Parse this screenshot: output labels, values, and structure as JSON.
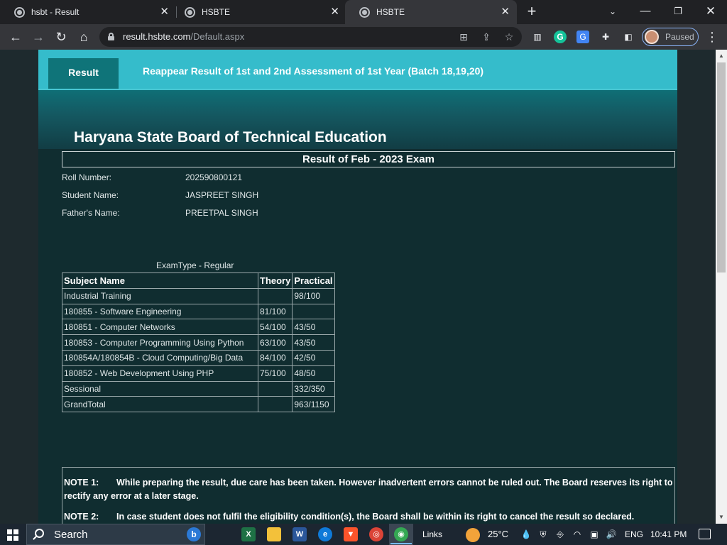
{
  "browser": {
    "tabs": [
      {
        "title": "hsbt - Result",
        "active": false
      },
      {
        "title": "HSBTE",
        "active": false
      },
      {
        "title": "HSBTE",
        "active": true
      }
    ],
    "new_tab_label": "+",
    "url_host": "result.hsbte.com",
    "url_path": "/Default.aspx",
    "profile_status": "Paused",
    "icons": [
      "back-icon",
      "forward-icon",
      "reload-icon",
      "home-icon",
      "lock-icon",
      "translate-icon",
      "share-icon",
      "star-icon",
      "extension-icon",
      "side-panel-icon",
      "menu-icon"
    ]
  },
  "site": {
    "nav_result": "Result",
    "nav_reappear": "Reappear Result of 1st and 2nd Assessment of 1st Year (Batch 18,19,20)",
    "board_title": "Haryana State Board of Technical Education",
    "result_heading": "Result of Feb - 2023 Exam",
    "student": {
      "roll_label": "Roll Number:",
      "roll_value": "202590800121",
      "name_label": "Student Name:",
      "name_value": "JASPREET SINGH",
      "father_label": "Father's Name:",
      "father_value": "PREETPAL SINGH"
    },
    "exam_type": "ExamType - Regular",
    "table": {
      "headers": [
        "Subject Name",
        "Theory",
        "Practical"
      ],
      "rows": [
        [
          "Industrial Training",
          "",
          "98/100"
        ],
        [
          "180855 - Software Engineering",
          "81/100",
          ""
        ],
        [
          "180851 - Computer Networks",
          "54/100",
          "43/50"
        ],
        [
          "180853 - Computer Programming Using Python",
          "63/100",
          "43/50"
        ],
        [
          "180854A/180854B - Cloud Computing/Big Data",
          "84/100",
          "42/50"
        ],
        [
          "180852 - Web Development Using PHP",
          "75/100",
          "48/50"
        ],
        [
          "Sessional",
          "",
          "332/350"
        ],
        [
          "GrandTotal",
          "",
          "963/1150"
        ]
      ]
    },
    "notes": [
      {
        "key": "NOTE 1:",
        "text": "While preparing the result, due care has been taken. However inadvertent errors cannot be ruled out. The Board reserves its right to rectify any error at a later stage."
      },
      {
        "key": "NOTE 2:",
        "text": "In case student does not fulfil the eligibility condition(s), the Board shall be within its right to cancel the result so declared."
      }
    ]
  },
  "taskbar": {
    "search_placeholder": "Search",
    "links_label": "Links",
    "weather": "25°C",
    "language": "ENG",
    "time": "10:41 PM"
  }
}
